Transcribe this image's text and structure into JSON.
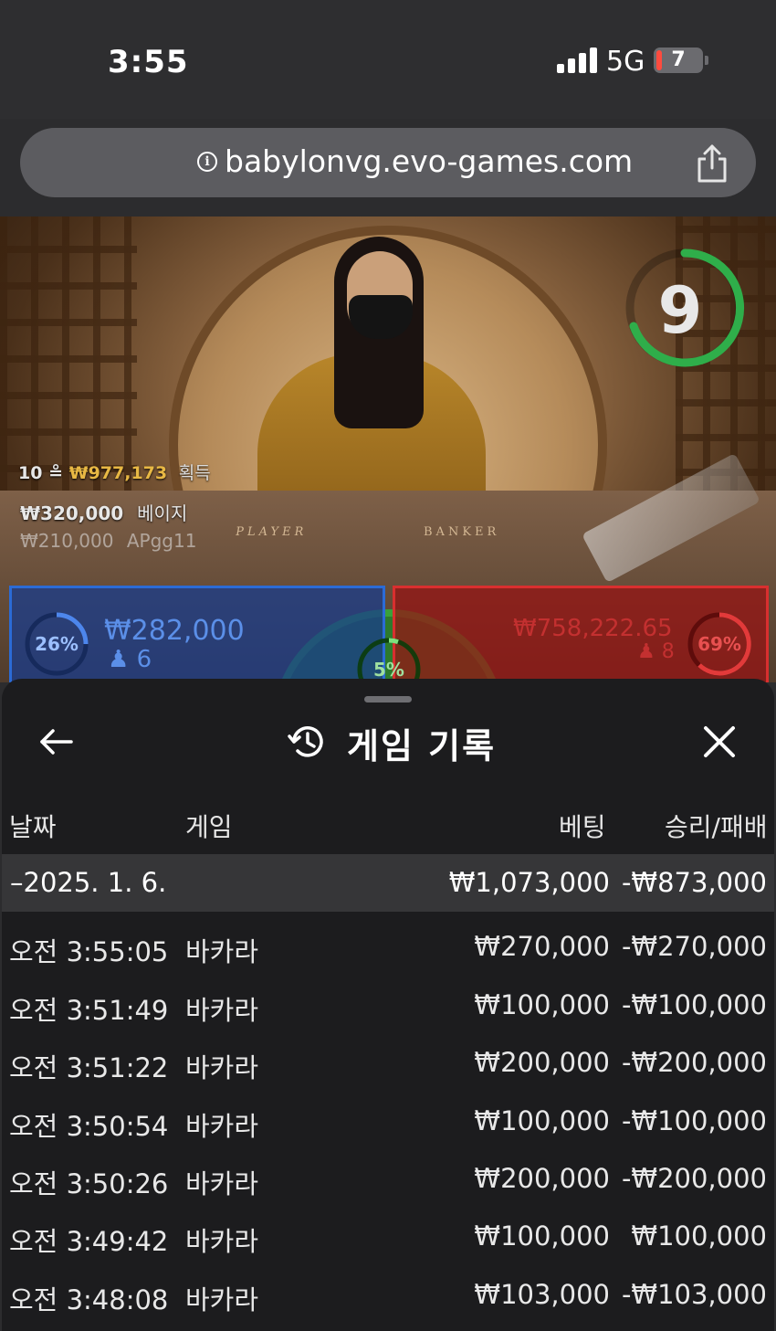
{
  "status_bar": {
    "time": "3:55",
    "network": "5G",
    "battery": "7"
  },
  "browser": {
    "url": "babylonvg.evo-games.com"
  },
  "video": {
    "timer": "9",
    "win_info": {
      "count": "10",
      "amount": "₩977,173",
      "label": "획득"
    },
    "bet_rows": [
      {
        "amount": "₩320,000",
        "label": "베이지"
      },
      {
        "amount": "₩210,000",
        "label": "APgg11"
      }
    ],
    "table_labels": {
      "player": "PLAYER",
      "banker": "BANKER"
    },
    "player_panel": {
      "percent": "26%",
      "amount": "₩282,000",
      "count": "6"
    },
    "banker_panel": {
      "percent": "69%",
      "amount": "₩758,222.65",
      "count": "8"
    },
    "tie_panel": {
      "percent": "5%"
    }
  },
  "sheet": {
    "title": "게임 기록",
    "columns": {
      "date": "날짜",
      "game": "게임",
      "bet": "베팅",
      "win_loss": "승리/패배"
    },
    "date_group": {
      "date": "–2025. 1. 6.",
      "bet": "₩1,073,000",
      "win_loss": "-₩873,000"
    },
    "rows": [
      {
        "time": "오전 3:55:05",
        "game": "바카라",
        "bet": "₩270,000",
        "win_loss": "-₩270,000"
      },
      {
        "time": "오전 3:51:49",
        "game": "바카라",
        "bet": "₩100,000",
        "win_loss": "-₩100,000"
      },
      {
        "time": "오전 3:51:22",
        "game": "바카라",
        "bet": "₩200,000",
        "win_loss": "-₩200,000"
      },
      {
        "time": "오전 3:50:54",
        "game": "바카라",
        "bet": "₩100,000",
        "win_loss": "-₩100,000"
      },
      {
        "time": "오전 3:50:26",
        "game": "바카라",
        "bet": "₩200,000",
        "win_loss": "-₩200,000"
      },
      {
        "time": "오전 3:49:42",
        "game": "바카라",
        "bet": "₩100,000",
        "win_loss": "₩100,000"
      },
      {
        "time": "오전 3:48:08",
        "game": "바카라",
        "bet": "₩103,000",
        "win_loss": "-₩103,000"
      }
    ]
  },
  "colors": {
    "player": "#2b6bd6",
    "banker": "#d92f2f",
    "tie": "#3aa13a",
    "timer": "#2fae4a"
  }
}
